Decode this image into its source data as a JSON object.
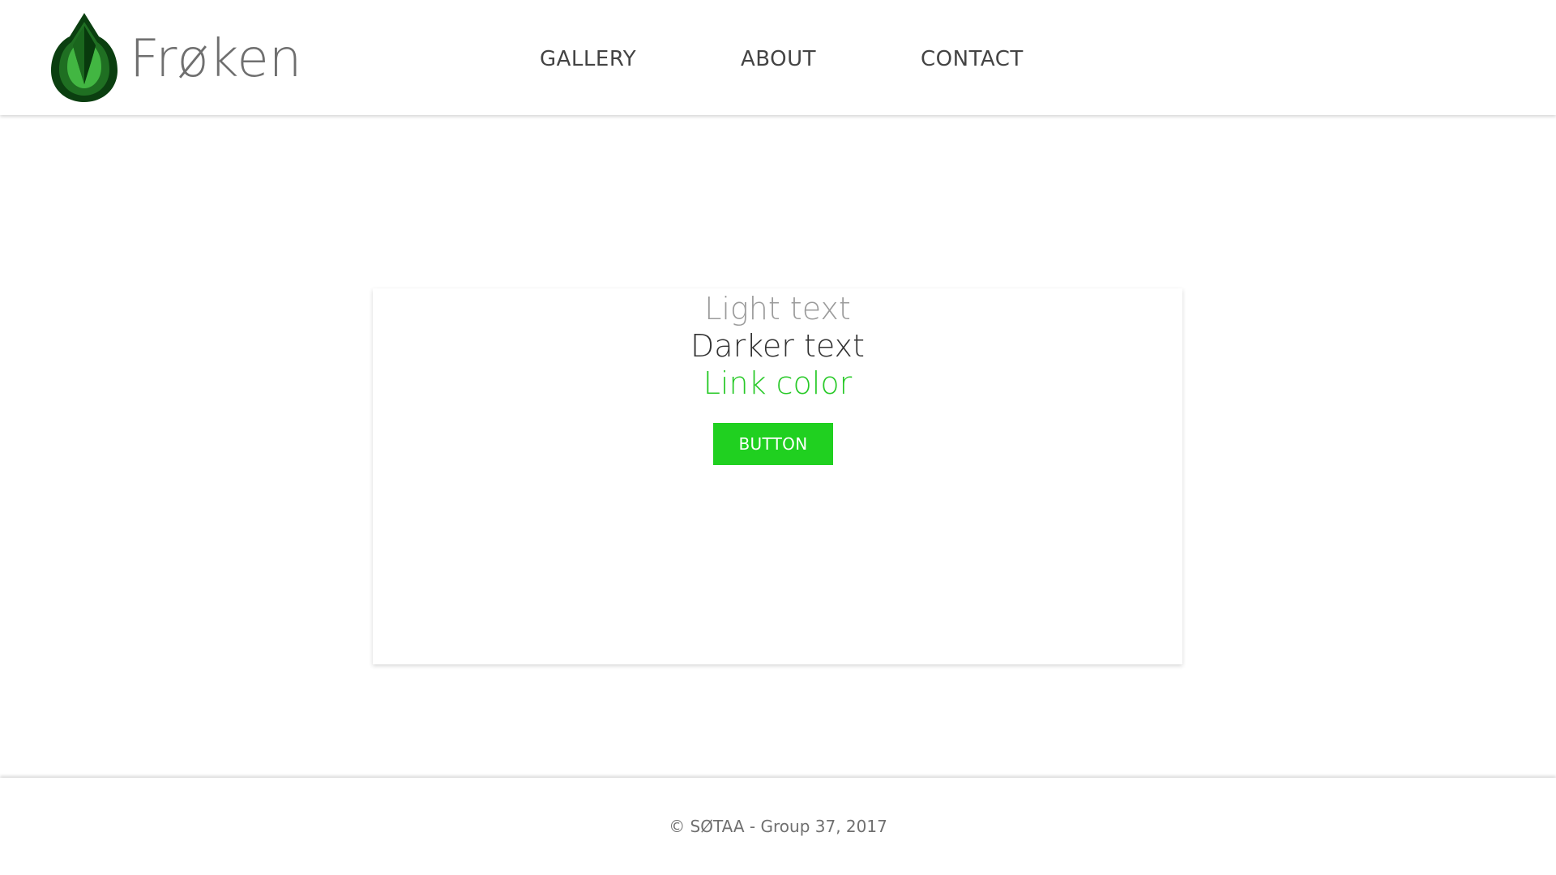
{
  "brand": {
    "name": "Frøken",
    "logo_icon": "leaf-drop-icon",
    "colors": {
      "dark_green": "#0f4d16",
      "mid_green": "#247a24",
      "light_green": "#40b840"
    }
  },
  "nav": {
    "items": [
      {
        "label": "GALLERY"
      },
      {
        "label": "ABOUT"
      },
      {
        "label": "CONTACT"
      }
    ]
  },
  "card": {
    "light_text": "Light text",
    "darker_text": "Darker text",
    "link_text": "Link color",
    "button_label": "BUTTON",
    "colors": {
      "light_text": "#9b9b9b",
      "darker_text": "#333333",
      "link": "#28c928",
      "button": "#20d020"
    }
  },
  "footer": {
    "copyright": "© SØTAA - Group 37, 2017"
  }
}
